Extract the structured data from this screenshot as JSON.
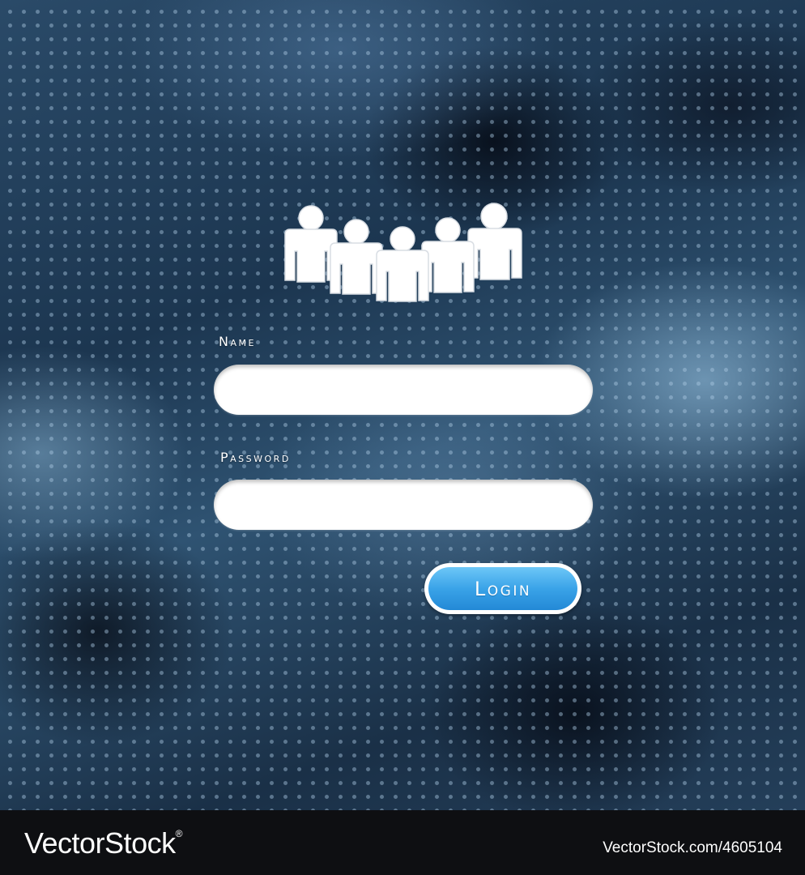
{
  "form": {
    "name_label": "Name",
    "name_value": "",
    "password_label": "Password",
    "password_value": "",
    "login_label": "Login"
  },
  "icons": {
    "users": "users-group-icon"
  },
  "footer": {
    "brand": "VectorStock",
    "brand_mark": "®",
    "image_id": "VectorStock.com/4605104"
  },
  "colors": {
    "login_button": "#3aa3e8",
    "background": "#1c3650",
    "input_fill": "#ffffff"
  }
}
